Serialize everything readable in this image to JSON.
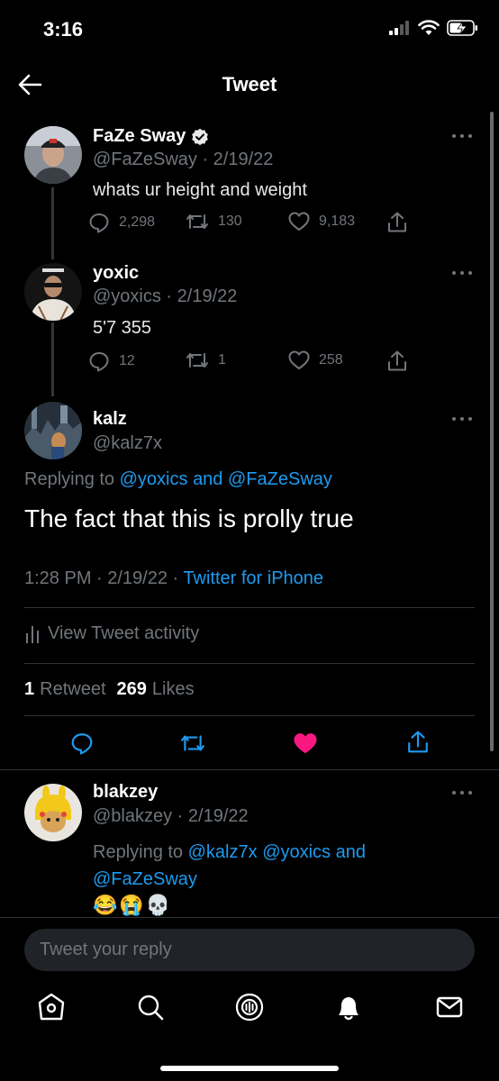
{
  "status_bar": {
    "time": "3:16"
  },
  "header": {
    "title": "Tweet"
  },
  "tweets": [
    {
      "name": "FaZe Sway",
      "verified": true,
      "handle_date": "@FaZeSway · 2/19/22",
      "text": "whats ur height and weight",
      "replies": "2,298",
      "retweets": "130",
      "likes": "9,183"
    },
    {
      "name": "yoxic",
      "handle_date": "@yoxics · 2/19/22",
      "text": "5'7 355",
      "replies": "12",
      "retweets": "1",
      "likes": "258"
    }
  ],
  "focused": {
    "name": "kalz",
    "handle": "@kalz7x",
    "replying_prefix": "Replying to",
    "replying_user1": "@yoxics",
    "replying_and": "and",
    "replying_user2": "@FaZeSway",
    "text": "The fact that this is prolly true",
    "time": "1:28 PM · 2/19/22 ·",
    "source": "Twitter for iPhone",
    "activity_label": "View Tweet activity",
    "retweet_count": "1",
    "retweet_label": "Retweet",
    "like_count": "269",
    "like_label": "Likes",
    "like_color": "#f91880"
  },
  "reply": {
    "name": "blakzey",
    "handle_date": "@blakzey · 2/19/22",
    "replying_prefix": "Replying to",
    "replying_user1": "@kalz7x",
    "replying_user2": "@yoxics",
    "replying_and": "and",
    "replying_user3": "@FaZeSway",
    "emojis": "😂😭💀"
  },
  "composer": {
    "placeholder": "Tweet your reply"
  },
  "tabs": [
    "home-icon",
    "search-icon",
    "spaces-icon",
    "notifications-icon",
    "messages-icon"
  ],
  "colors": {
    "accent": "#1d9bf0",
    "like": "#f91880",
    "background": "#000000"
  }
}
